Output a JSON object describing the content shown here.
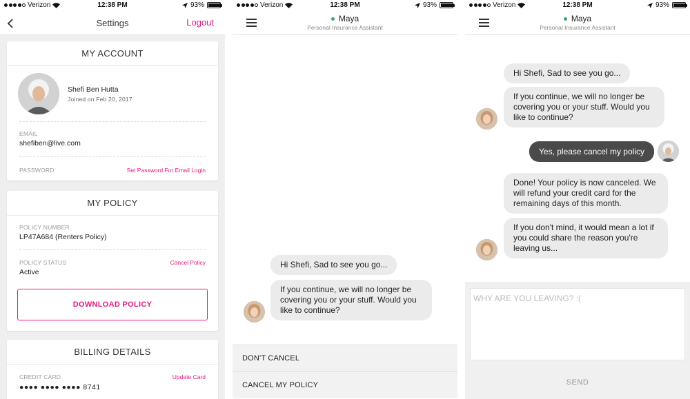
{
  "status_bar": {
    "carrier": "Verizon",
    "time": "12:38 PM",
    "battery": "93%"
  },
  "settings": {
    "title": "Settings",
    "logout": "Logout",
    "my_account": {
      "title": "MY ACCOUNT",
      "name": "Shefi Ben Hutta",
      "joined": "Joined on Feb 20, 2017",
      "email_label": "EMAIL",
      "email": "shefiben@live.com",
      "password_label": "PASSWORD",
      "password_link": "Set Password For Email Login"
    },
    "my_policy": {
      "title": "MY POLICY",
      "number_label": "POLICY NUMBER",
      "number": "LP47A684 (Renters Policy)",
      "status_label": "POLICY STATUS",
      "status": "Active",
      "cancel_link": "Cancel Policy",
      "download": "DOWNLOAD POLICY"
    },
    "billing": {
      "title": "BILLING DETAILS",
      "card_label": "CREDIT CARD",
      "card": "●●●● ●●●● ●●●● 8741",
      "update_link": "Update Card"
    }
  },
  "chat": {
    "name": "Maya",
    "subtitle": "Personal Insurance Assistant",
    "msg_hi": "Hi Shefi, Sad to see you go...",
    "msg_continue": "If you continue, we will no longer be covering you or your stuff. Would you like to continue?",
    "option_dont_cancel": "DON'T CANCEL",
    "option_cancel": "CANCEL MY POLICY",
    "msg_user_cancel": "Yes, please cancel my policy",
    "msg_done": "Done! Your policy is now canceled. We will refund your credit card for the remaining days of this month.",
    "msg_reason": "If you don't mind, it would mean a lot if you could share the reason you're leaving us...",
    "reply_placeholder": "WHY ARE YOU LEAVING? :(",
    "send": "SEND"
  },
  "colors": {
    "accent": "#e8177f",
    "online": "#2db06a",
    "user_bubble": "#4a4a4a",
    "bot_bubble": "#ebebeb"
  }
}
